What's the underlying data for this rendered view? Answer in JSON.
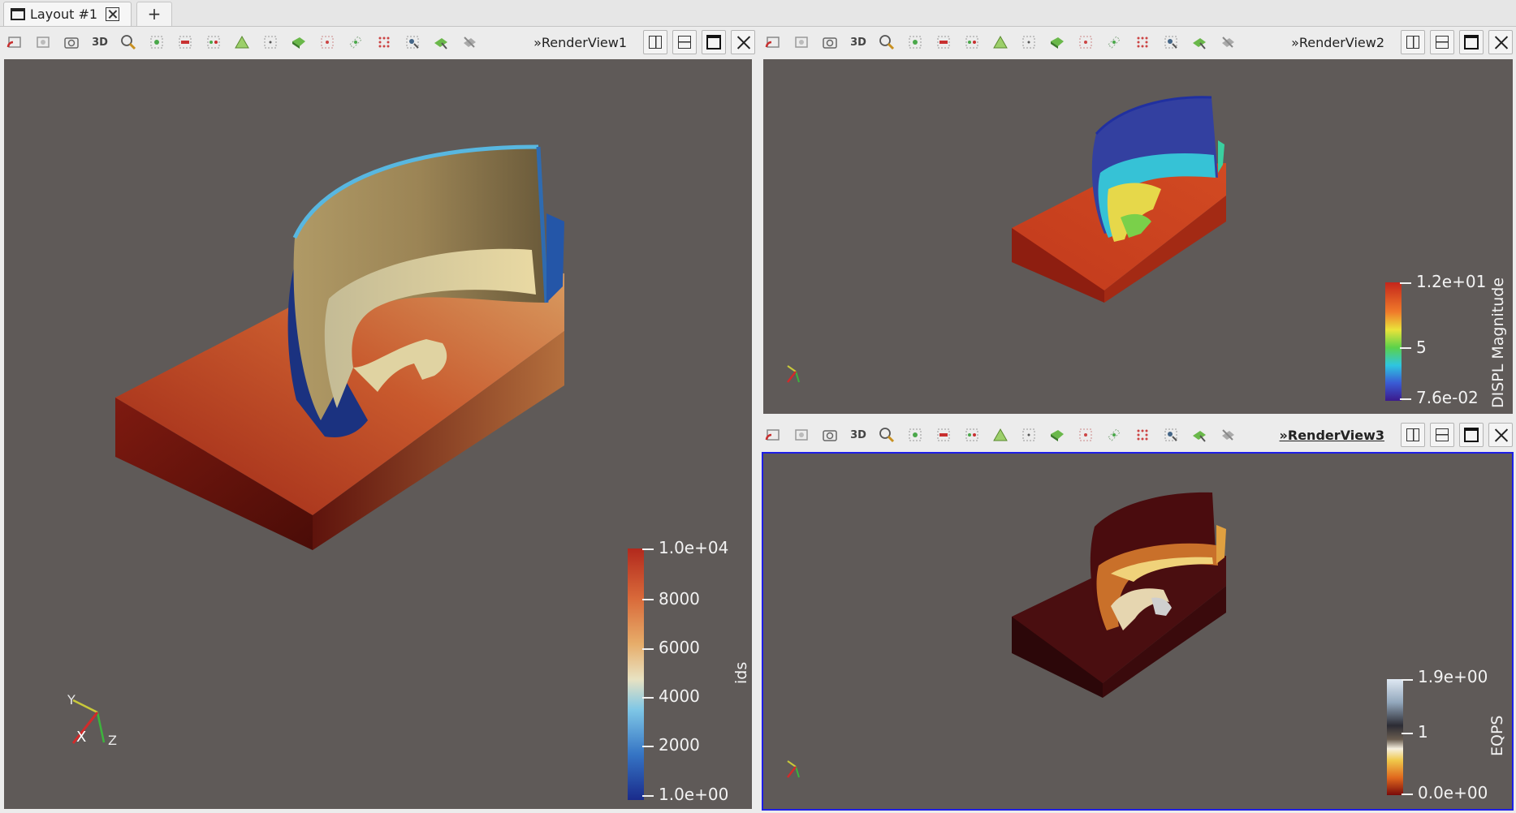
{
  "tab": {
    "label": "Layout #1"
  },
  "add_tab": {
    "label": "+"
  },
  "toolbar_icons": [
    "reset-camera",
    "zoom-closest",
    "screenshot",
    "3D",
    "zoom-to-box",
    "select-cells-on",
    "deselect",
    "select-points-on",
    "select-cells-frustum",
    "select-points-frustum",
    "select-polygon-cells",
    "select-polygon-points",
    "interactive-select-cells",
    "interactive-select-points",
    "hover-points",
    "hover-cells",
    "clear-selection"
  ],
  "toolbar_3d_label": "3D",
  "views": {
    "rv1": {
      "title": "RenderView1",
      "prefix": "»"
    },
    "rv2": {
      "title": "RenderView2",
      "prefix": "»"
    },
    "rv3": {
      "title": "RenderView3",
      "prefix": "»"
    }
  },
  "colorbars": {
    "ids": {
      "title": "ids",
      "labels": [
        "1.0e+04",
        "8000",
        "6000",
        "4000",
        "2000",
        "1.0e+00"
      ]
    },
    "displ": {
      "title": "DISPL Magnitude",
      "labels": [
        "1.2e+01",
        "5",
        "7.6e-02"
      ]
    },
    "eqps": {
      "title": "EQPS",
      "labels": [
        "1.9e+00",
        "1",
        "0.0e+00"
      ]
    }
  },
  "axes": {
    "x": "X",
    "y": "Y",
    "z": "Z"
  },
  "colors": {
    "background": "#5f5a58",
    "active_border": "#1e1ee6"
  }
}
